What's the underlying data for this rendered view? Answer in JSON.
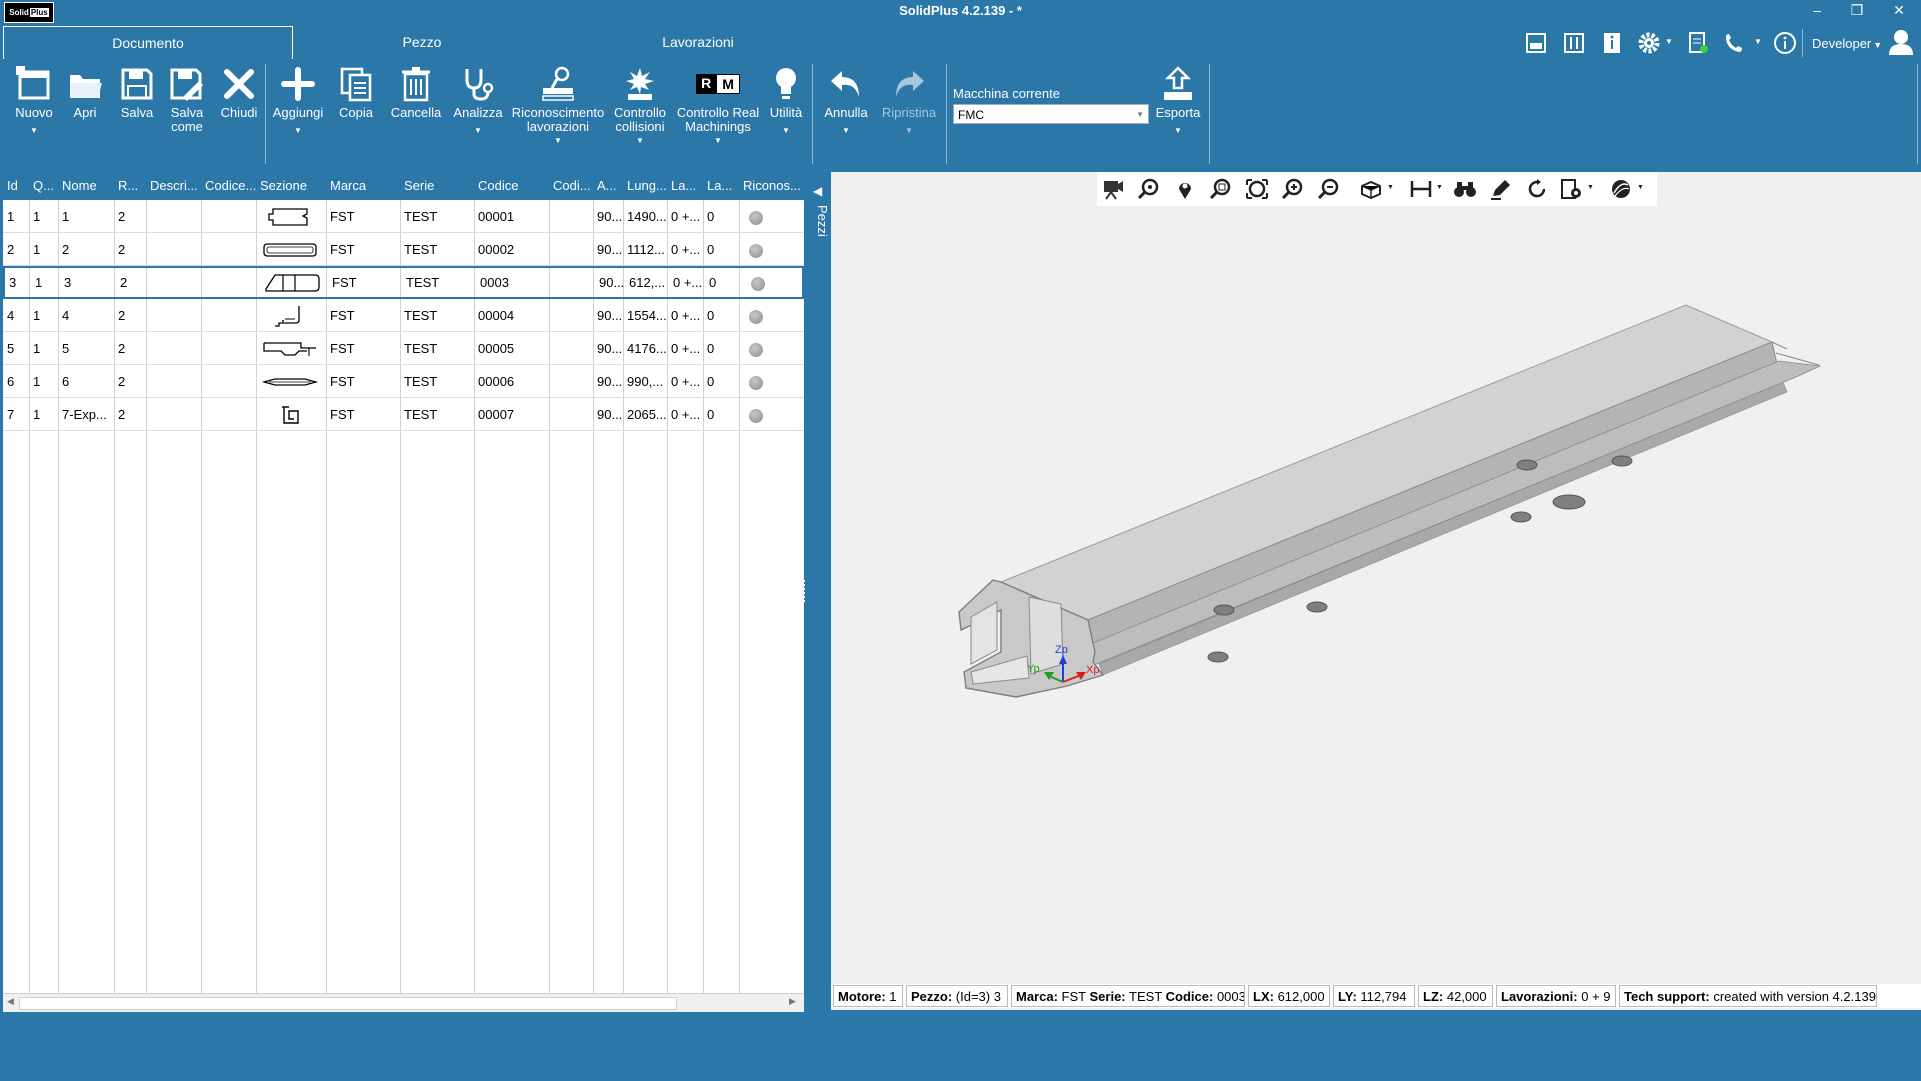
{
  "app": {
    "title": "SolidPlus  4.2.139 - *",
    "logo_left": "Solid",
    "logo_right": "Plus"
  },
  "tabs": [
    {
      "label": "Documento"
    },
    {
      "label": "Pezzo"
    },
    {
      "label": "Lavorazioni"
    }
  ],
  "user": {
    "name": "Developer"
  },
  "ribbon": {
    "nuovo": "Nuovo",
    "apri": "Apri",
    "salva": "Salva",
    "salva_come_1": "Salva",
    "salva_come_2": "come",
    "chiudi": "Chiudi",
    "aggiungi": "Aggiungi",
    "copia": "Copia",
    "cancella": "Cancella",
    "analizza": "Analizza",
    "riconoscimento_1": "Riconoscimento",
    "riconoscimento_2": "lavorazioni",
    "controllo_collisioni_1": "Controllo",
    "controllo_collisioni_2": "collisioni",
    "rm_r": "R",
    "rm_m": "M",
    "controllo_real_1": "Controllo Real",
    "controllo_real_2": "Machinings",
    "utilita": "Utilità",
    "annulla": "Annulla",
    "ripristina": "Ripristina",
    "macchina_label": "Macchina corrente",
    "macchina_value": "FMC",
    "esporta": "Esporta"
  },
  "grid": {
    "headers": [
      "Id",
      "Q...",
      "Nome",
      "R...",
      "Descri...",
      "Codice...",
      "Sezione",
      "Marca",
      "Serie",
      "Codice",
      "Codi...",
      "A...",
      "Lung...",
      "La...",
      "La...",
      "Riconos..."
    ],
    "rows": [
      {
        "id": "1",
        "q": "1",
        "nome": "1",
        "r": "2",
        "marca": "FST",
        "serie": "TEST",
        "codice": "00001",
        "a": "90...",
        "lung": "1490...",
        "la1": "0 +...",
        "la2": "0"
      },
      {
        "id": "2",
        "q": "1",
        "nome": "2",
        "r": "2",
        "marca": "FST",
        "serie": "TEST",
        "codice": "00002",
        "a": "90...",
        "lung": "1112...",
        "la1": "0 +...",
        "la2": "0"
      },
      {
        "id": "3",
        "q": "1",
        "nome": "3",
        "r": "2",
        "marca": "FST",
        "serie": "TEST",
        "codice": "0003",
        "a": "90...",
        "lung": "612,...",
        "la1": "0 +...",
        "la2": "0"
      },
      {
        "id": "4",
        "q": "1",
        "nome": "4",
        "r": "2",
        "marca": "FST",
        "serie": "TEST",
        "codice": "00004",
        "a": "90...",
        "lung": "1554...",
        "la1": "0 +...",
        "la2": "0"
      },
      {
        "id": "5",
        "q": "1",
        "nome": "5",
        "r": "2",
        "marca": "FST",
        "serie": "TEST",
        "codice": "00005",
        "a": "90...",
        "lung": "4176...",
        "la1": "0 +...",
        "la2": "0"
      },
      {
        "id": "6",
        "q": "1",
        "nome": "6",
        "r": "2",
        "marca": "FST",
        "serie": "TEST",
        "codice": "00006",
        "a": "90...",
        "lung": "990,...",
        "la1": "0 +...",
        "la2": "0"
      },
      {
        "id": "7",
        "q": "1",
        "nome": "7-Exp...",
        "r": "2",
        "marca": "FST",
        "serie": "TEST",
        "codice": "00007",
        "a": "90...",
        "lung": "2065...",
        "la1": "0 +...",
        "la2": "0"
      }
    ]
  },
  "side_tab": {
    "label": "Pezzi"
  },
  "axes": {
    "z": "Zp",
    "x": "Xp",
    "y": "Yp"
  },
  "status": {
    "motore_k": "Motore:",
    "motore_v": "1",
    "pezzo_k": "Pezzo:",
    "pezzo_v": "(Id=3) 3",
    "marca_k": "Marca:",
    "marca_v": "FST",
    "serie_k": "Serie:",
    "serie_v": "TEST",
    "codice_k": "Codice:",
    "codice_v": "0003",
    "lx_k": "LX:",
    "lx_v": "612,000",
    "ly_k": "LY:",
    "ly_v": "112,794",
    "lz_k": "LZ:",
    "lz_v": "42,000",
    "lav_k": "Lavorazioni:",
    "lav_v": "0 + 9",
    "tech_k": "Tech support:",
    "tech_v": "created with version 4.2.139"
  },
  "colors": {
    "accent": "#2b77a8",
    "viewport_bg": "#f0f0f0"
  }
}
